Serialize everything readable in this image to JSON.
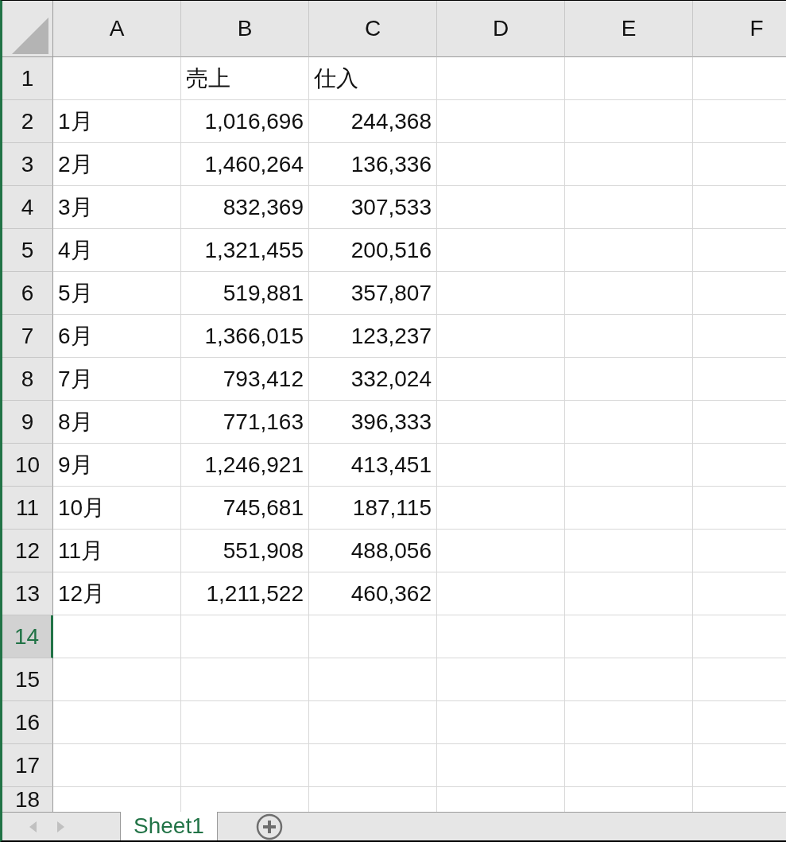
{
  "columns": [
    {
      "label": "A"
    },
    {
      "label": "B"
    },
    {
      "label": "C"
    },
    {
      "label": "D"
    },
    {
      "label": "E"
    },
    {
      "label": "F"
    }
  ],
  "rows": [
    {
      "number": "1",
      "selected": false,
      "cells": [
        {
          "kind": "blank"
        },
        {
          "kind": "text",
          "text": "売上"
        },
        {
          "kind": "text",
          "text": "仕入"
        }
      ]
    },
    {
      "number": "2",
      "selected": false,
      "cells": [
        {
          "kind": "text",
          "text": "1月"
        },
        {
          "kind": "number",
          "text": "1,016,696"
        },
        {
          "kind": "number",
          "text": "244,368"
        }
      ]
    },
    {
      "number": "3",
      "selected": false,
      "cells": [
        {
          "kind": "text",
          "text": "2月"
        },
        {
          "kind": "number",
          "text": "1,460,264"
        },
        {
          "kind": "number",
          "text": "136,336"
        }
      ]
    },
    {
      "number": "4",
      "selected": false,
      "cells": [
        {
          "kind": "text",
          "text": "3月"
        },
        {
          "kind": "number",
          "text": "832,369"
        },
        {
          "kind": "number",
          "text": "307,533"
        }
      ]
    },
    {
      "number": "5",
      "selected": false,
      "cells": [
        {
          "kind": "text",
          "text": "4月"
        },
        {
          "kind": "number",
          "text": "1,321,455"
        },
        {
          "kind": "number",
          "text": "200,516"
        }
      ]
    },
    {
      "number": "6",
      "selected": false,
      "cells": [
        {
          "kind": "text",
          "text": "5月"
        },
        {
          "kind": "number",
          "text": "519,881"
        },
        {
          "kind": "number",
          "text": "357,807"
        }
      ]
    },
    {
      "number": "7",
      "selected": false,
      "cells": [
        {
          "kind": "text",
          "text": "6月"
        },
        {
          "kind": "number",
          "text": "1,366,015"
        },
        {
          "kind": "number",
          "text": "123,237"
        }
      ]
    },
    {
      "number": "8",
      "selected": false,
      "cells": [
        {
          "kind": "text",
          "text": "7月"
        },
        {
          "kind": "number",
          "text": "793,412"
        },
        {
          "kind": "number",
          "text": "332,024"
        }
      ]
    },
    {
      "number": "9",
      "selected": false,
      "cells": [
        {
          "kind": "text",
          "text": "8月"
        },
        {
          "kind": "number",
          "text": "771,163"
        },
        {
          "kind": "number",
          "text": "396,333"
        }
      ]
    },
    {
      "number": "10",
      "selected": false,
      "cells": [
        {
          "kind": "text",
          "text": "9月"
        },
        {
          "kind": "number",
          "text": "1,246,921"
        },
        {
          "kind": "number",
          "text": "413,451"
        }
      ]
    },
    {
      "number": "11",
      "selected": false,
      "cells": [
        {
          "kind": "text",
          "text": "10月"
        },
        {
          "kind": "number",
          "text": "745,681"
        },
        {
          "kind": "number",
          "text": "187,115"
        }
      ]
    },
    {
      "number": "12",
      "selected": false,
      "cells": [
        {
          "kind": "text",
          "text": "11月"
        },
        {
          "kind": "number",
          "text": "551,908"
        },
        {
          "kind": "number",
          "text": "488,056"
        }
      ]
    },
    {
      "number": "13",
      "selected": false,
      "cells": [
        {
          "kind": "text",
          "text": "12月"
        },
        {
          "kind": "number",
          "text": "1,211,522"
        },
        {
          "kind": "number",
          "text": "460,362"
        }
      ]
    },
    {
      "number": "14",
      "selected": true,
      "cells": []
    },
    {
      "number": "15",
      "selected": false,
      "cells": []
    },
    {
      "number": "16",
      "selected": false,
      "cells": []
    },
    {
      "number": "17",
      "selected": false,
      "cells": []
    },
    {
      "number": "18",
      "selected": false,
      "cells": []
    }
  ],
  "sheet_tabs": [
    {
      "label": "Sheet1",
      "selected": true
    }
  ]
}
